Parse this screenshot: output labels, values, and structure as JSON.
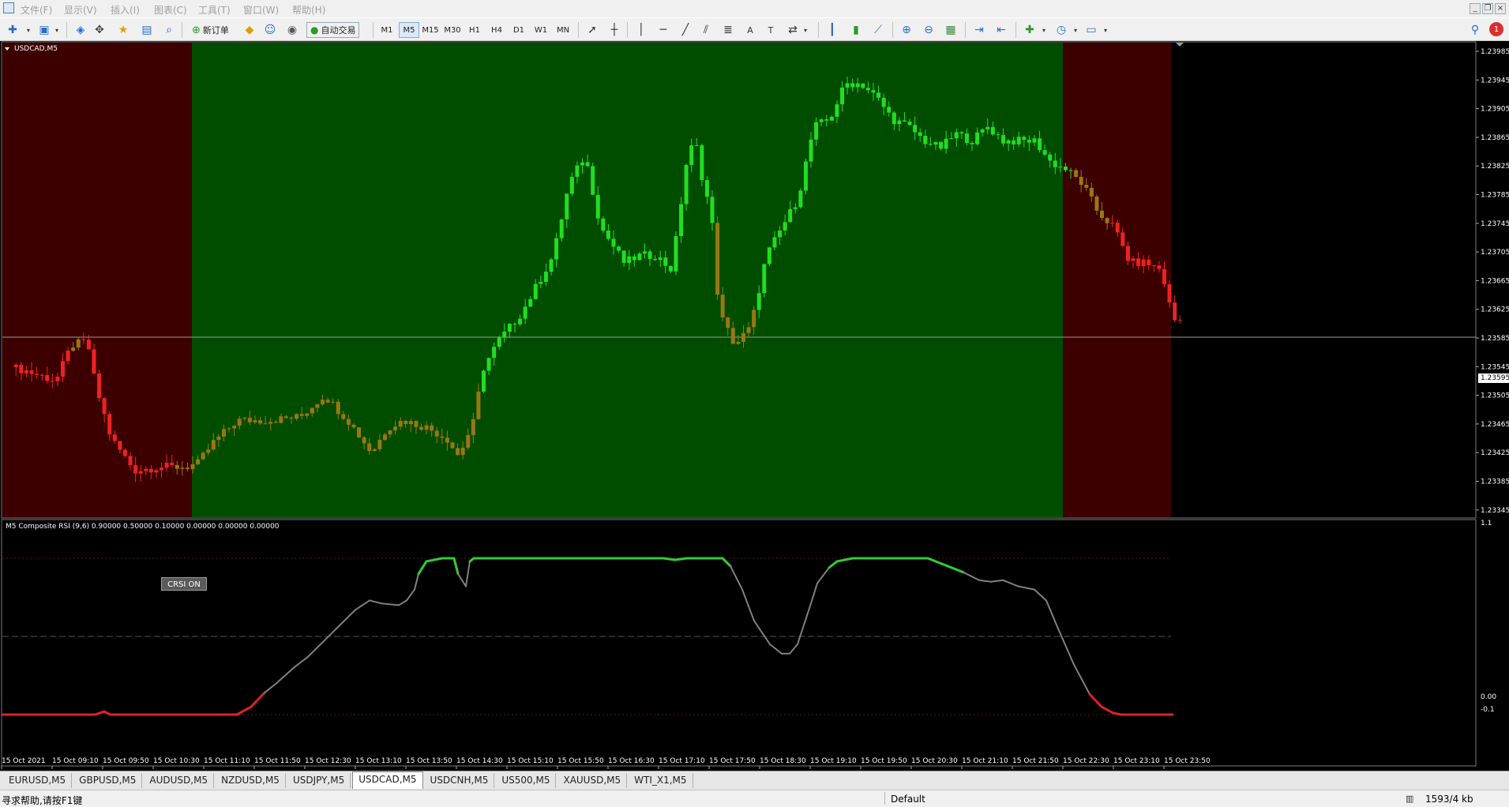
{
  "menu": {
    "items": [
      "文件(F)",
      "显示(V)",
      "插入(I)",
      "图表(C)",
      "工具(T)",
      "窗口(W)",
      "帮助(H)"
    ]
  },
  "toolbar": {
    "new_order_label": "新订单",
    "auto_trade_label": "自动交易",
    "timeframes": [
      "M1",
      "M5",
      "M15",
      "M30",
      "H1",
      "H4",
      "D1",
      "W1",
      "MN"
    ],
    "active_timeframe": "M5",
    "notification_count": "1"
  },
  "chart": {
    "symbol_label": "USDCAD,M5",
    "indicator_label": "M5 Composite RSI (9,6) 0.90000 0.50000 0.10000 0.00000 0.00000 0.00000",
    "crsi_button_label": "CRSI ON",
    "current_price": "1.23595",
    "price_axis": [
      "1.23985",
      "1.23945",
      "1.23905",
      "1.23865",
      "1.23825",
      "1.23785",
      "1.23745",
      "1.23705",
      "1.23665",
      "1.23625",
      "1.23585",
      "1.23545",
      "1.23505",
      "1.23465",
      "1.23425",
      "1.23385",
      "1.23345"
    ],
    "indicator_axis": [
      "1.1",
      "0.00",
      "-0.1"
    ],
    "time_axis": [
      "15 Oct 2021",
      "15 Oct 09:10",
      "15 Oct 09:50",
      "15 Oct 10:30",
      "15 Oct 11:10",
      "15 Oct 11:50",
      "15 Oct 12:30",
      "15 Oct 13:10",
      "15 Oct 13:50",
      "15 Oct 14:30",
      "15 Oct 15:10",
      "15 Oct 15:50",
      "15 Oct 16:30",
      "15 Oct 17:10",
      "15 Oct 17:50",
      "15 Oct 18:30",
      "15 Oct 19:10",
      "15 Oct 19:50",
      "15 Oct 20:30",
      "15 Oct 21:10",
      "15 Oct 21:50",
      "15 Oct 22:30",
      "15 Oct 23:10",
      "15 Oct 23:50"
    ],
    "colors": {
      "bull_zone": "#004d00",
      "bear_zone": "#3d0000",
      "up_candle": "#22dd22",
      "down_candle": "#ee2222",
      "mid_candle": "#997711",
      "crsi_line": "#808080",
      "crsi_high": "#33cc33",
      "crsi_low": "#dd2222"
    }
  },
  "chart_data": {
    "type": "line",
    "title": "M5 Composite RSI (9,6) 0.90000 0.50000 0.10000 0.00000 0.00000 0.00000",
    "xlabel": "",
    "ylabel": "",
    "ylim": [
      -0.1,
      1.1
    ],
    "grid": false,
    "x": [
      "15 Oct 2021",
      "15 Oct 09:10",
      "15 Oct 09:50",
      "15 Oct 10:30",
      "15 Oct 11:10",
      "15 Oct 11:50",
      "15 Oct 12:30",
      "15 Oct 13:10",
      "15 Oct 13:50",
      "15 Oct 14:30",
      "15 Oct 15:10",
      "15 Oct 15:50",
      "15 Oct 16:30",
      "15 Oct 17:10",
      "15 Oct 17:50",
      "15 Oct 18:30",
      "15 Oct 19:10",
      "15 Oct 19:50",
      "15 Oct 20:30",
      "15 Oct 21:10",
      "15 Oct 21:50",
      "15 Oct 22:30",
      "15 Oct 23:10",
      "15 Oct 23:50"
    ],
    "series": [
      {
        "name": "",
        "values": [
          0.0,
          0.0,
          0.0,
          0.0,
          0.0,
          0.12,
          0.48,
          0.79,
          1.0,
          1.0,
          1.0,
          1.0,
          1.0,
          1.0,
          1.0,
          0.38,
          0.98,
          1.0,
          1.0,
          0.84,
          0.75,
          0.1,
          0.0,
          0.0
        ]
      }
    ],
    "reference_lines": [
      0.9,
      0.5,
      0.1
    ]
  },
  "tabs": {
    "items": [
      "EURUSD,M5",
      "GBPUSD,M5",
      "AUDUSD,M5",
      "NZDUSD,M5",
      "USDJPY,M5",
      "USDCAD,M5",
      "USDCNH,M5",
      "US500,M5",
      "XAUUSD,M5",
      "WTI_X1,M5"
    ],
    "active": "USDCAD,M5"
  },
  "status": {
    "help_text": "寻求帮助,请按F1键",
    "profile": "Default",
    "traffic": "1593/4 kb"
  }
}
